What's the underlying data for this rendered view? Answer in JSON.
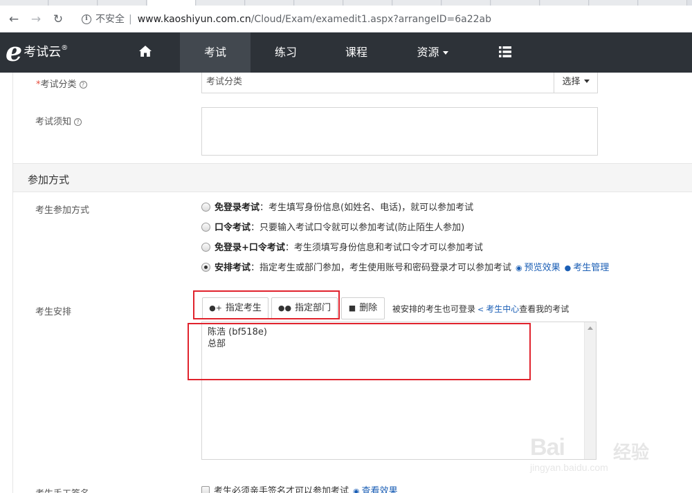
{
  "browser": {
    "insecure_label": "不安全",
    "url_host": "www.kaoshiyun.com.cn",
    "url_path": "/Cloud/Exam/examedit1.aspx?arrangeID=6a22ab"
  },
  "logo": {
    "text": "考试云",
    "mark": "®"
  },
  "nav": {
    "home_icon": "home-icon",
    "items": [
      {
        "label": "考试"
      },
      {
        "label": "练习"
      },
      {
        "label": "课程"
      },
      {
        "label": "资源"
      }
    ],
    "menu_icon": "list-icon"
  },
  "form": {
    "category": {
      "label": "考试分类",
      "value": "考试分类",
      "select_label": "选择"
    },
    "notice": {
      "label": "考试须知",
      "value": ""
    }
  },
  "join_section": {
    "title": "参加方式",
    "label": "考生参加方式",
    "options": [
      {
        "title": "免登录考试",
        "desc": "：考生填写身份信息(如姓名、电话)，就可以参加考试",
        "checked": false
      },
      {
        "title": "口令考试",
        "desc": "：只要输入考试口令就可以参加考试(防止陌生人参加)",
        "checked": false
      },
      {
        "title": "免登录+口令考试",
        "desc": "：考生须填写身份信息和考试口令才可以参加考试",
        "checked": false
      },
      {
        "title": "安排考试",
        "desc": "：指定考生或部门参加，考生使用账号和密码登录才可以参加考试",
        "checked": true
      }
    ],
    "preview_link": "预览效果",
    "manage_link": "考生管理"
  },
  "arrange": {
    "label": "考生安排",
    "assign_student_button": "指定考生",
    "assign_dept_button": "指定部门",
    "delete_button": "删除",
    "hint_prefix": "被安排的考生也可登录",
    "hint_link": "考生中心",
    "hint_suffix": "查看我的考试",
    "entries": [
      "陈浩 (bf518e)",
      "总部"
    ]
  },
  "signature": {
    "label": "考生手工签名",
    "checkbox_label": "考生必须亲手签名才可以参加考试",
    "view_link": "查看效果"
  },
  "watermark": {
    "brand": "Bai",
    "cn": "经验",
    "url": "jingyan.baidu.com"
  },
  "colors": {
    "nav_bg": "#2d3238",
    "nav_active": "#42484f",
    "link": "#1a5eb5",
    "highlight": "#e0222c"
  }
}
